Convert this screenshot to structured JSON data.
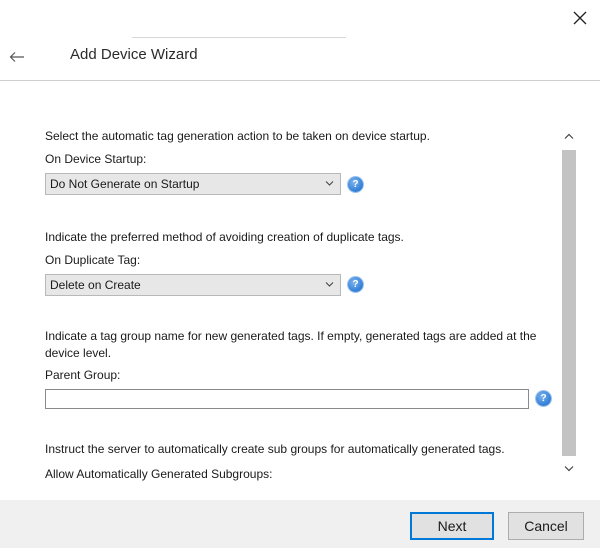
{
  "window": {
    "close_label": "✕"
  },
  "header": {
    "title": "Add Device Wizard"
  },
  "settings": {
    "startup_description": "Select the automatic tag generation action to be taken on device startup.",
    "startup_label": "On Device Startup:",
    "startup_value": "Do Not Generate on Startup",
    "duplicate_description": "Indicate the preferred method of avoiding creation of duplicate tags.",
    "duplicate_label": "On Duplicate Tag:",
    "duplicate_value": "Delete on Create",
    "parent_description": "Indicate a tag group name for new generated tags. If empty, generated tags are added at the device level.",
    "parent_label": "Parent Group:",
    "parent_value": "",
    "subgroups_description": "Instruct the server to automatically create sub groups for automatically generated tags.",
    "subgroups_label": "Allow Automatically Generated Subgroups:"
  },
  "footer": {
    "next_label": "Next",
    "cancel_label": "Cancel"
  },
  "colors": {
    "accent": "#0078d7",
    "help_icon": "#2f7dd6",
    "footer_bg": "#f0f0f0"
  }
}
